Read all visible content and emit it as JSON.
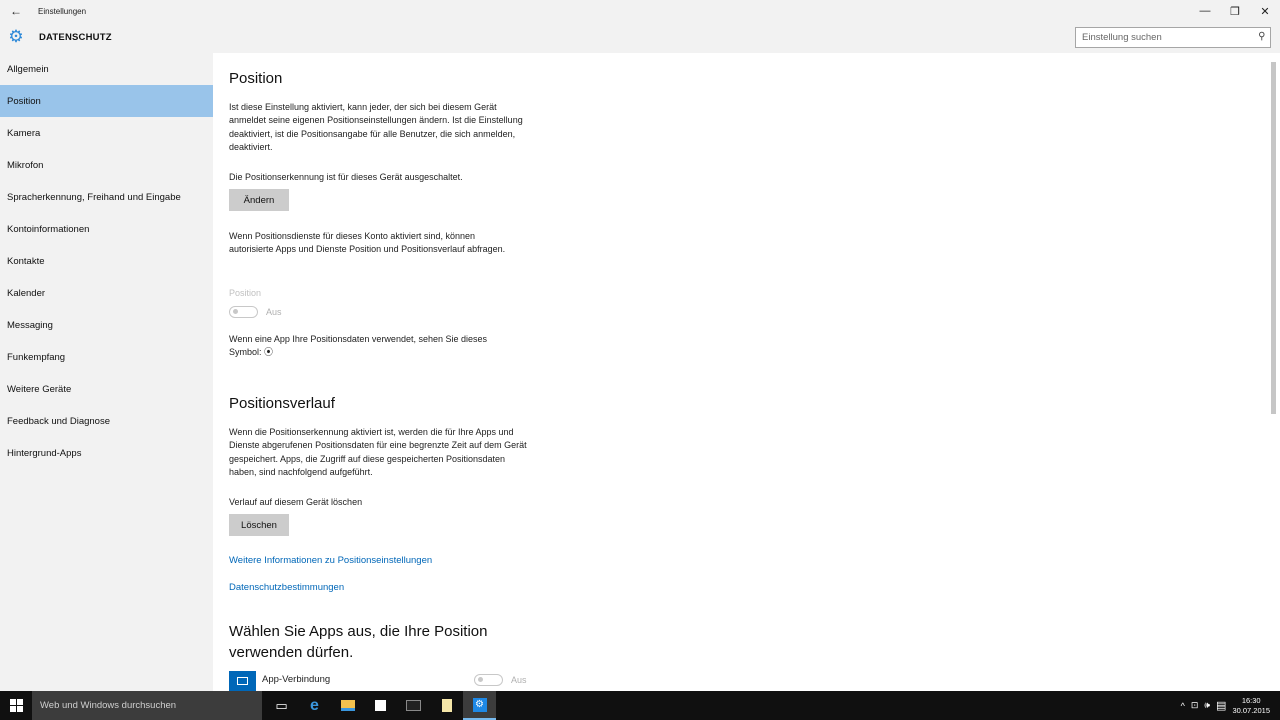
{
  "window": {
    "title": "Einstellungen",
    "back": "←",
    "minimize": "—",
    "restore": "❐",
    "close": "✕"
  },
  "header": {
    "section_title": "DATENSCHUTZ",
    "search_placeholder": "Einstellung suchen",
    "gear": "⚙",
    "search_glyph": "⚲"
  },
  "sidebar": {
    "items": [
      {
        "label": "Allgemein"
      },
      {
        "label": "Position"
      },
      {
        "label": "Kamera"
      },
      {
        "label": "Mikrofon"
      },
      {
        "label": "Spracherkennung, Freihand und Eingabe"
      },
      {
        "label": "Kontoinformationen"
      },
      {
        "label": "Kontakte"
      },
      {
        "label": "Kalender"
      },
      {
        "label": "Messaging"
      },
      {
        "label": "Funkempfang"
      },
      {
        "label": "Weitere Geräte"
      },
      {
        "label": "Feedback und Diagnose"
      },
      {
        "label": "Hintergrund-Apps"
      }
    ]
  },
  "main": {
    "position_heading": "Position",
    "intro_text": "Ist diese Einstellung aktiviert, kann jeder, der sich bei diesem Gerät anmeldet seine eigenen Positionseinstellungen ändern. Ist die Einstellung deaktiviert, ist die Positionsangabe für alle Benutzer, die sich anmelden, deaktiviert.",
    "device_status": "Die Positionserkennung ist für dieses Gerät ausgeschaltet.",
    "change_button": "Ändern",
    "account_text": "Wenn Positionsdienste für dieses Konto aktiviert sind, können autorisierte Apps und Dienste Position und Positionsverlauf abfragen.",
    "position_toggle_label": "Position",
    "position_toggle_state": "Aus",
    "symbol_text": "Wenn eine App Ihre Positionsdaten verwendet, sehen Sie dieses Symbol:",
    "symbol_glyph": "⦿",
    "history_heading": "Positionsverlauf",
    "history_text": "Wenn die Positionserkennung aktiviert ist, werden die für Ihre Apps und Dienste abgerufenen Positionsdaten für eine begrenzte Zeit auf dem Gerät gespeichert. Apps, die Zugriff auf diese gespeicherten Positionsdaten haben, sind nachfolgend aufgeführt.",
    "clear_history_label": "Verlauf auf diesem Gerät löschen",
    "clear_button": "Löschen",
    "more_info_link": "Weitere Informationen zu Positionseinstellungen",
    "privacy_link": "Datenschutzbestimmungen",
    "apps_heading": "Wählen Sie Apps aus, die Ihre Position verwenden dürfen.",
    "apps": [
      {
        "name": "App-Verbindung",
        "state": "Aus"
      }
    ]
  },
  "taskbar": {
    "search_text": "Web und Windows durchsuchen",
    "time": "16:30",
    "date": "30.07.2015",
    "tray_glyphs": {
      "chevron": "^",
      "network": "⊡",
      "volume": "🕪",
      "notifications": "▤"
    },
    "task_view_glyph": "▭",
    "edge_glyph": "e"
  },
  "colors": {
    "accent": "#0067b8",
    "selection": "#99c4ea",
    "chrome": "#f2f2f2",
    "taskbar": "#101010"
  }
}
